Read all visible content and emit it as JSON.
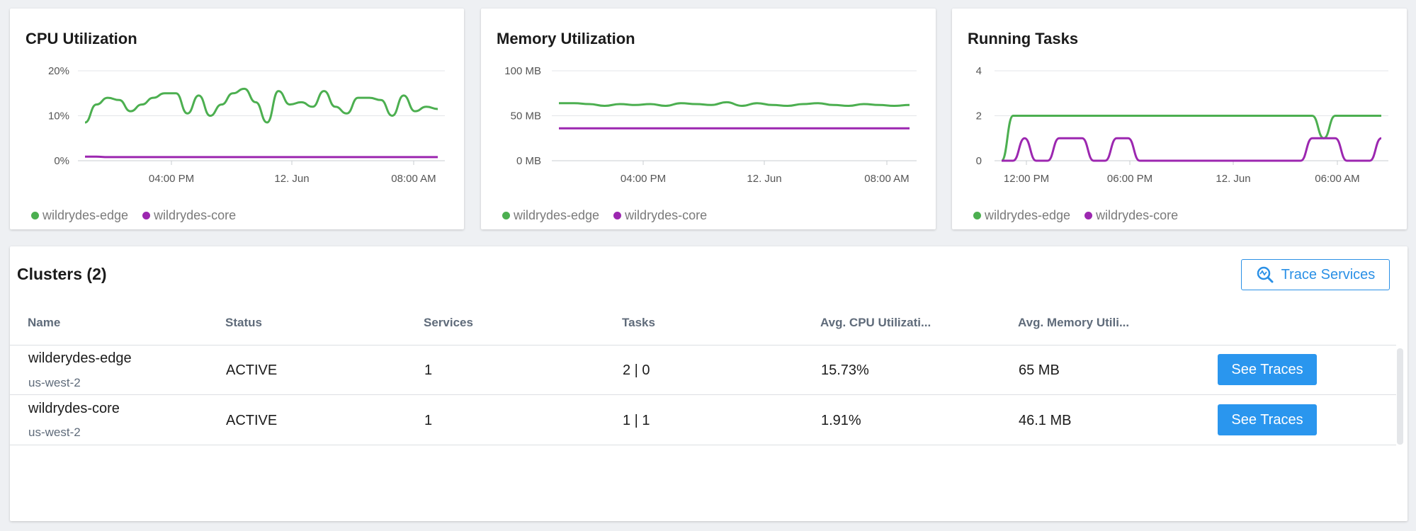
{
  "charts": [
    {
      "title": "CPU Utilization",
      "y_ticks": [
        "20%",
        "10%",
        "0%"
      ],
      "x_ticks": [
        "04:00 PM",
        "12. Jun",
        "08:00 AM"
      ],
      "legend": [
        "wildrydes-edge",
        "wildrydes-core"
      ]
    },
    {
      "title": "Memory Utilization",
      "y_ticks": [
        "100 MB",
        "50 MB",
        "0 MB"
      ],
      "x_ticks": [
        "04:00 PM",
        "12. Jun",
        "08:00 AM"
      ],
      "legend": [
        "wildrydes-edge",
        "wildrydes-core"
      ]
    },
    {
      "title": "Running Tasks",
      "y_ticks": [
        "4",
        "2",
        "0"
      ],
      "x_ticks": [
        "12:00 PM",
        "06:00 PM",
        "12. Jun",
        "06:00 AM"
      ],
      "legend": [
        "wildrydes-edge",
        "wildrydes-core"
      ]
    }
  ],
  "chart_data": [
    {
      "type": "line",
      "title": "CPU Utilization",
      "ylim": [
        0,
        20
      ],
      "y_unit": "%",
      "x_ticks": [
        "04:00 PM",
        "12. Jun",
        "08:00 AM"
      ],
      "series": [
        {
          "name": "wildrydes-edge",
          "values": [
            8.5,
            12.5,
            14,
            13.5,
            11,
            12.5,
            14,
            15,
            15,
            10.5,
            14.5,
            10,
            12.5,
            15,
            16,
            13,
            8.5,
            15.5,
            12.5,
            13,
            12,
            15.5,
            12,
            10.5,
            14,
            14,
            13.5,
            10,
            14.5,
            11,
            12,
            11.5
          ]
        },
        {
          "name": "wildrydes-core",
          "values": [
            0.9,
            0.9,
            0.8,
            0.8,
            0.8,
            0.8,
            0.8,
            0.8,
            0.8,
            0.8,
            0.8,
            0.8,
            0.8,
            0.8,
            0.8,
            0.8,
            0.8,
            0.8,
            0.8,
            0.8,
            0.8,
            0.8,
            0.8,
            0.8,
            0.8,
            0.8,
            0.8,
            0.8,
            0.8,
            0.8,
            0.8,
            0.8
          ]
        }
      ],
      "legend": "bottom-left",
      "grid": true,
      "colors": {
        "wildrydes-edge": "#4caf50",
        "wildrydes-core": "#9c27b0"
      }
    },
    {
      "type": "line",
      "title": "Memory Utilization",
      "ylim": [
        0,
        100
      ],
      "y_unit": "MB",
      "x_ticks": [
        "04:00 PM",
        "12. Jun",
        "08:00 AM"
      ],
      "series": [
        {
          "name": "wildrydes-edge",
          "values": [
            64,
            64,
            63,
            61,
            63,
            62,
            63,
            61,
            64,
            63,
            62,
            65,
            61,
            64,
            62,
            61,
            63,
            64,
            62,
            61,
            63,
            62,
            61,
            62
          ]
        },
        {
          "name": "wildrydes-core",
          "values": [
            36,
            36,
            36,
            36,
            36,
            36,
            36,
            36,
            36,
            36,
            36,
            36,
            36,
            36,
            36,
            36,
            36,
            36,
            36,
            36,
            36,
            36,
            36,
            36
          ]
        }
      ],
      "legend": "bottom-left",
      "grid": true,
      "colors": {
        "wildrydes-edge": "#4caf50",
        "wildrydes-core": "#9c27b0"
      }
    },
    {
      "type": "line",
      "title": "Running Tasks",
      "ylim": [
        0,
        4
      ],
      "x_ticks": [
        "12:00 PM",
        "06:00 PM",
        "12. Jun",
        "06:00 AM"
      ],
      "series": [
        {
          "name": "wildrydes-edge",
          "values": [
            0,
            2,
            2,
            2,
            2,
            2,
            2,
            2,
            2,
            2,
            2,
            2,
            2,
            2,
            2,
            2,
            2,
            2,
            2,
            2,
            2,
            2,
            2,
            2,
            2,
            2,
            2,
            2,
            1,
            2,
            2,
            2,
            2,
            2
          ]
        },
        {
          "name": "wildrydes-core",
          "values": [
            0,
            0,
            1,
            0,
            0,
            1,
            1,
            1,
            0,
            0,
            1,
            1,
            0,
            0,
            0,
            0,
            0,
            0,
            0,
            0,
            0,
            0,
            0,
            0,
            0,
            0,
            0,
            1,
            1,
            1,
            0,
            0,
            0,
            1
          ]
        }
      ],
      "legend": "bottom-left",
      "grid": true,
      "colors": {
        "wildrydes-edge": "#4caf50",
        "wildrydes-core": "#9c27b0"
      }
    }
  ],
  "clusters": {
    "title": "Clusters (2)",
    "trace_button": "Trace Services",
    "columns": [
      "Name",
      "Status",
      "Services",
      "Tasks",
      "Avg. CPU Utilizati...",
      "Avg. Memory Utili..."
    ],
    "rows": [
      {
        "name": "wilderydes-edge",
        "region": "us-west-2",
        "status": "ACTIVE",
        "services": "1",
        "tasks": "2 | 0",
        "cpu": "15.73%",
        "memory": "65 MB",
        "action": "See Traces"
      },
      {
        "name": "wildrydes-core",
        "region": "us-west-2",
        "status": "ACTIVE",
        "services": "1",
        "tasks": "1 | 1",
        "cpu": "1.91%",
        "memory": "46.1 MB",
        "action": "See Traces"
      }
    ]
  },
  "colors": {
    "accent": "#2a96ee",
    "edge": "#4caf50",
    "core": "#9c27b0"
  }
}
